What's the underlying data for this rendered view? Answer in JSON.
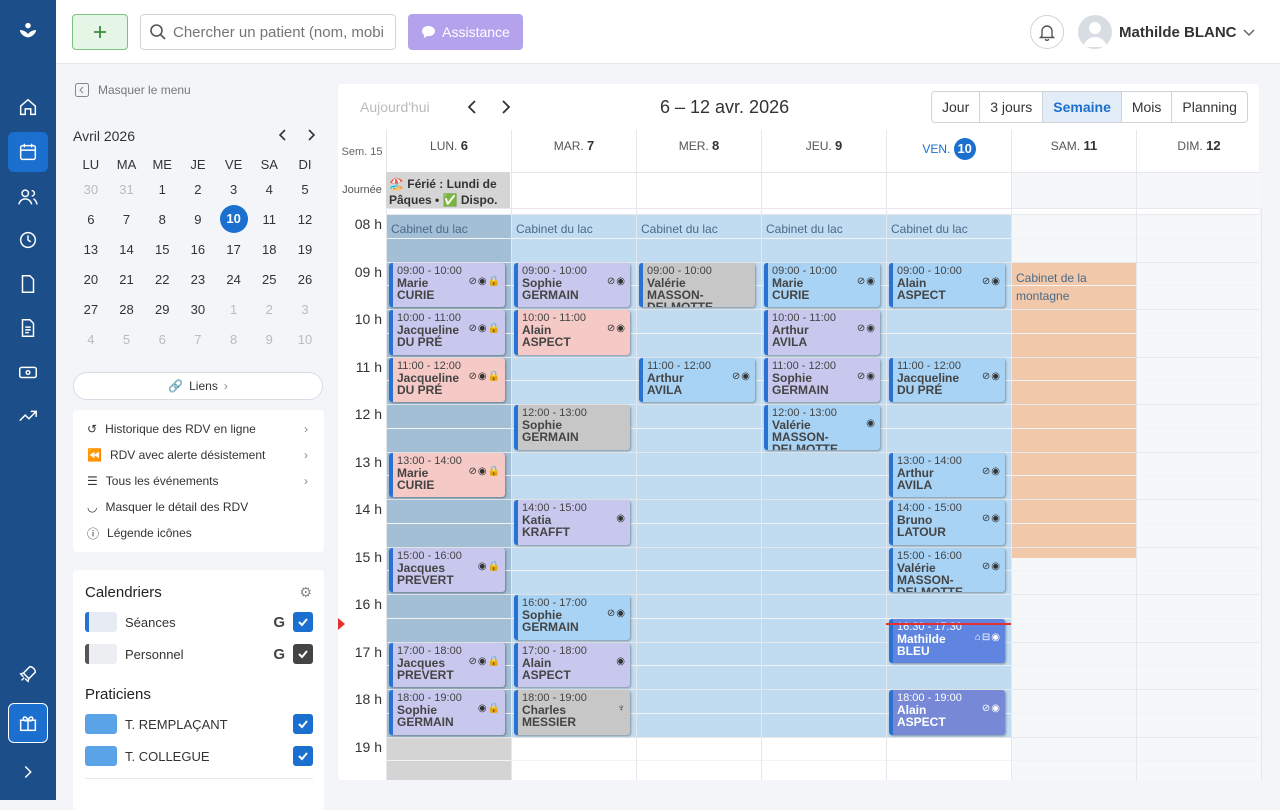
{
  "search": {
    "placeholder": "Chercher un patient (nom, mobile...)"
  },
  "assist_label": "Assistance",
  "user": {
    "name": "Mathilde BLANC"
  },
  "left": {
    "hide_menu": "Masquer le menu",
    "month_title": "Avril 2026",
    "weekdays": [
      "LU",
      "MA",
      "ME",
      "JE",
      "VE",
      "SA",
      "DI"
    ],
    "weeks": [
      [
        "30",
        "31",
        "1",
        "2",
        "3",
        "4",
        "5"
      ],
      [
        "6",
        "7",
        "8",
        "9",
        "10",
        "11",
        "12"
      ],
      [
        "13",
        "14",
        "15",
        "16",
        "17",
        "18",
        "19"
      ],
      [
        "20",
        "21",
        "22",
        "23",
        "24",
        "25",
        "26"
      ],
      [
        "27",
        "28",
        "29",
        "30",
        "1",
        "2",
        "3"
      ],
      [
        "4",
        "5",
        "6",
        "7",
        "8",
        "9",
        "10"
      ]
    ],
    "links": "Liens",
    "menu": [
      "Historique des RDV en ligne",
      "RDV avec alerte désistement",
      "Tous les événements",
      "Masquer le détail des RDV",
      "Légende icônes"
    ],
    "calendars_title": "Calendriers",
    "calendars": [
      "Séances",
      "Personnel"
    ],
    "praticiens_title": "Praticiens",
    "praticiens": [
      "T. REMPLAÇANT",
      "T. COLLEGUE"
    ]
  },
  "main": {
    "today": "Aujourd'hui",
    "title": "6 – 12 avr. 2026",
    "views": [
      "Jour",
      "3 jours",
      "Semaine",
      "Mois",
      "Planning"
    ],
    "week": "Sem. 15",
    "journee": "Journée",
    "days": [
      {
        "dow": "LUN.",
        "num": "6"
      },
      {
        "dow": "MAR.",
        "num": "7"
      },
      {
        "dow": "MER.",
        "num": "8"
      },
      {
        "dow": "JEU.",
        "num": "9"
      },
      {
        "dow": "VEN.",
        "num": "10"
      },
      {
        "dow": "SAM.",
        "num": "11"
      },
      {
        "dow": "DIM.",
        "num": "12"
      }
    ],
    "ferie": "🏖️ Férié : Lundi de Pâques • ✅ Dispo.",
    "hours": [
      "08 h",
      "09 h",
      "10 h",
      "11 h",
      "12 h",
      "13 h",
      "14 h",
      "15 h",
      "16 h",
      "17 h",
      "18 h",
      "19 h"
    ],
    "zone_lac": "Cabinet du lac",
    "zone_montagne": "Cabinet de la montagne",
    "events": [
      {
        "day": 0,
        "time": "09:00 - 10:00",
        "name": "Marie CURIE",
        "style": "lav",
        "icons": "⊘◉🔒"
      },
      {
        "day": 0,
        "time": "10:00 - 11:00",
        "name": "Jacqueline DU PRÉ",
        "style": "lav",
        "icons": "⊘◉🔒"
      },
      {
        "day": 0,
        "time": "11:00 - 12:00",
        "name": "Jacqueline DU PRÉ",
        "style": "pink",
        "icons": "⊘◉🔒"
      },
      {
        "day": 0,
        "time": "13:00 - 14:00",
        "name": "Marie CURIE",
        "style": "pink",
        "icons": "⊘◉🔒"
      },
      {
        "day": 0,
        "time": "15:00 - 16:00",
        "name": "Jacques PREVERT",
        "style": "lav",
        "icons": "◉🔒"
      },
      {
        "day": 0,
        "time": "17:00 - 18:00",
        "name": "Jacques PREVERT",
        "style": "lav",
        "icons": "⊘◉🔒"
      },
      {
        "day": 0,
        "time": "18:00 - 19:00",
        "name": "Sophie GERMAIN",
        "style": "lav",
        "icons": "◉🔒"
      },
      {
        "day": 1,
        "time": "09:00 - 10:00",
        "name": "Sophie GERMAIN",
        "style": "lav",
        "icons": "⊘◉"
      },
      {
        "day": 1,
        "time": "10:00 - 11:00",
        "name": "Alain ASPECT",
        "style": "pink",
        "icons": "⊘◉"
      },
      {
        "day": 1,
        "time": "12:00 - 13:00",
        "name": "Sophie GERMAIN",
        "style": "grey",
        "icons": ""
      },
      {
        "day": 1,
        "time": "14:00 - 15:00",
        "name": "Katia KRAFFT",
        "style": "lav",
        "icons": "◉"
      },
      {
        "day": 1,
        "time": "16:00 - 17:00",
        "name": "Sophie GERMAIN",
        "style": "blue",
        "icons": "⊘◉"
      },
      {
        "day": 1,
        "time": "17:00 - 18:00",
        "name": "Alain ASPECT",
        "style": "lav",
        "icons": "◉"
      },
      {
        "day": 1,
        "time": "18:00 - 19:00",
        "name": "Charles MESSIER",
        "style": "grey",
        "icons": "♆"
      },
      {
        "day": 2,
        "time": "09:00 - 10:00",
        "name": "Valérie MASSON-DELMOTTE",
        "style": "grey",
        "icons": ""
      },
      {
        "day": 2,
        "time": "11:00 - 12:00",
        "name": "Arthur AVILA",
        "style": "blue",
        "icons": "⊘◉"
      },
      {
        "day": 3,
        "time": "09:00 - 10:00",
        "name": "Marie CURIE",
        "style": "blue",
        "icons": "⊘◉"
      },
      {
        "day": 3,
        "time": "10:00 - 11:00",
        "name": "Arthur AVILA",
        "style": "lav",
        "icons": "⊘◉"
      },
      {
        "day": 3,
        "time": "11:00 - 12:00",
        "name": "Sophie GERMAIN",
        "style": "lav",
        "icons": "⊘◉"
      },
      {
        "day": 3,
        "time": "12:00 - 13:00",
        "name": "Valérie MASSON-DELMOTTE",
        "style": "blue",
        "icons": "◉"
      },
      {
        "day": 4,
        "time": "09:00 - 10:00",
        "name": "Alain ASPECT",
        "style": "blue",
        "icons": "⊘◉"
      },
      {
        "day": 4,
        "time": "11:00 - 12:00",
        "name": "Jacqueline DU PRÉ",
        "style": "blue",
        "icons": "⊘◉"
      },
      {
        "day": 4,
        "time": "13:00 - 14:00",
        "name": "Arthur AVILA",
        "style": "blue",
        "icons": "⊘◉"
      },
      {
        "day": 4,
        "time": "14:00 - 15:00",
        "name": "Bruno LATOUR",
        "style": "blue",
        "icons": "⊘◉"
      },
      {
        "day": 4,
        "time": "15:00 - 16:00",
        "name": "Valérie MASSON-DELMOTTE",
        "style": "blue",
        "icons": "⊘◉"
      },
      {
        "day": 4,
        "time": "16:30 - 17:30",
        "name": "Mathilde BLEU",
        "style": "dark",
        "icons": "⌂⊟◉"
      },
      {
        "day": 4,
        "time": "18:00 - 19:00",
        "name": "Alain ASPECT",
        "style": "dark2",
        "icons": "⊘◉"
      }
    ]
  },
  "colors": {
    "rail": "#1c4e8a",
    "accent": "#1a6fcf",
    "lac": "#c1dcf1",
    "lac_closed": "#a3bfd6",
    "montagne": "#f1c8aa",
    "assist": "#b4a3ec"
  }
}
